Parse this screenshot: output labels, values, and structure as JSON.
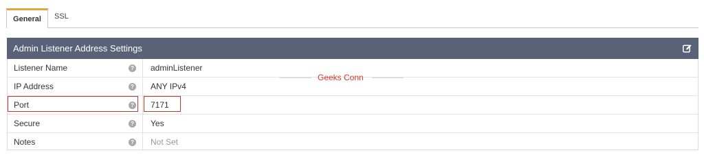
{
  "tabs": [
    {
      "label": "General",
      "active": true
    },
    {
      "label": "SSL",
      "active": false
    }
  ],
  "panel": {
    "title": "Admin Listener Address Settings",
    "edit_icon": "edit-icon",
    "rows": [
      {
        "label": "Listener Name",
        "value": "adminListener",
        "muted": false
      },
      {
        "label": "IP Address",
        "value": "ANY IPv4",
        "muted": false
      },
      {
        "label": "Port",
        "value": "7171",
        "muted": false
      },
      {
        "label": "Secure",
        "value": "Yes",
        "muted": false
      },
      {
        "label": "Notes",
        "value": "Not Set",
        "muted": true
      }
    ],
    "help_glyph": "?"
  },
  "watermark": "Geeks Conn",
  "colors": {
    "accent_tab": "#e8a33b",
    "header_bg": "#5a6278",
    "highlight": "#c0392b",
    "watermark": "#d9342b"
  }
}
